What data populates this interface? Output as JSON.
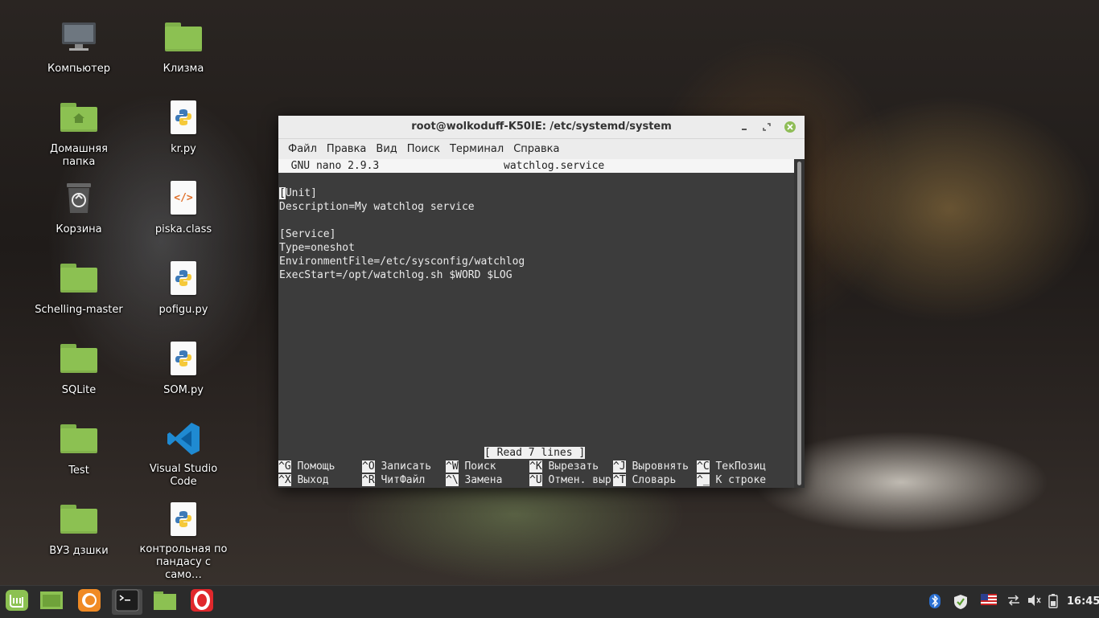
{
  "desktop": {
    "col1": [
      {
        "label": "Компьютер",
        "icon": "computer-icon"
      },
      {
        "label": "Домашняя папка",
        "icon": "home-folder-icon"
      },
      {
        "label": "Корзина",
        "icon": "trash-icon"
      },
      {
        "label": "Schelling-master",
        "icon": "folder-icon"
      },
      {
        "label": "SQLite",
        "icon": "folder-icon"
      },
      {
        "label": "Test",
        "icon": "folder-icon"
      },
      {
        "label": "ВУЗ дзшки",
        "icon": "folder-icon"
      }
    ],
    "col2": [
      {
        "label": "Клизма",
        "icon": "folder-icon"
      },
      {
        "label": "kr.py",
        "icon": "python-file-icon"
      },
      {
        "label": "piska.class",
        "icon": "code-file-icon"
      },
      {
        "label": "pofigu.py",
        "icon": "python-file-icon"
      },
      {
        "label": "SOM.py",
        "icon": "python-file-icon"
      },
      {
        "label": "Visual Studio Code",
        "icon": "vscode-icon"
      },
      {
        "label": "контрольная по пандасу с само…",
        "icon": "python-file-icon"
      }
    ]
  },
  "window": {
    "title": "root@wolkoduff-K50IE: /etc/systemd/system",
    "menu": [
      "Файл",
      "Правка",
      "Вид",
      "Поиск",
      "Терминал",
      "Справка"
    ]
  },
  "nano": {
    "version": "  GNU nano 2.9.3",
    "filename": "watchlog.service",
    "cursor_char": "[",
    "lines": [
      "Unit]",
      "Description=My watchlog service",
      "",
      "[Service]",
      "Type=oneshot",
      "EnvironmentFile=/etc/sysconfig/watchlog",
      "ExecStart=/opt/watchlog.sh $WORD $LOG"
    ],
    "status": "[ Read 7 lines ]",
    "shortcuts_row1": [
      {
        "key": "^G",
        "label": "Помощь"
      },
      {
        "key": "^O",
        "label": "Записать"
      },
      {
        "key": "^W",
        "label": "Поиск"
      },
      {
        "key": "^K",
        "label": "Вырезать"
      },
      {
        "key": "^J",
        "label": "Выровнять"
      },
      {
        "key": "^C",
        "label": "ТекПозиц"
      }
    ],
    "shortcuts_row2": [
      {
        "key": "^X",
        "label": "Выход"
      },
      {
        "key": "^R",
        "label": "ЧитФайл"
      },
      {
        "key": "^\\",
        "label": "Замена"
      },
      {
        "key": "^U",
        "label": "Отмен. выр"
      },
      {
        "key": "^T",
        "label": "Словарь"
      },
      {
        "key": "^_",
        "label": "К строке"
      }
    ]
  },
  "taskbar": {
    "clock": "16:45",
    "apps": [
      "mint-menu-icon",
      "show-desktop-icon",
      "firefox-icon",
      "terminal-icon",
      "files-icon",
      "opera-icon"
    ]
  }
}
